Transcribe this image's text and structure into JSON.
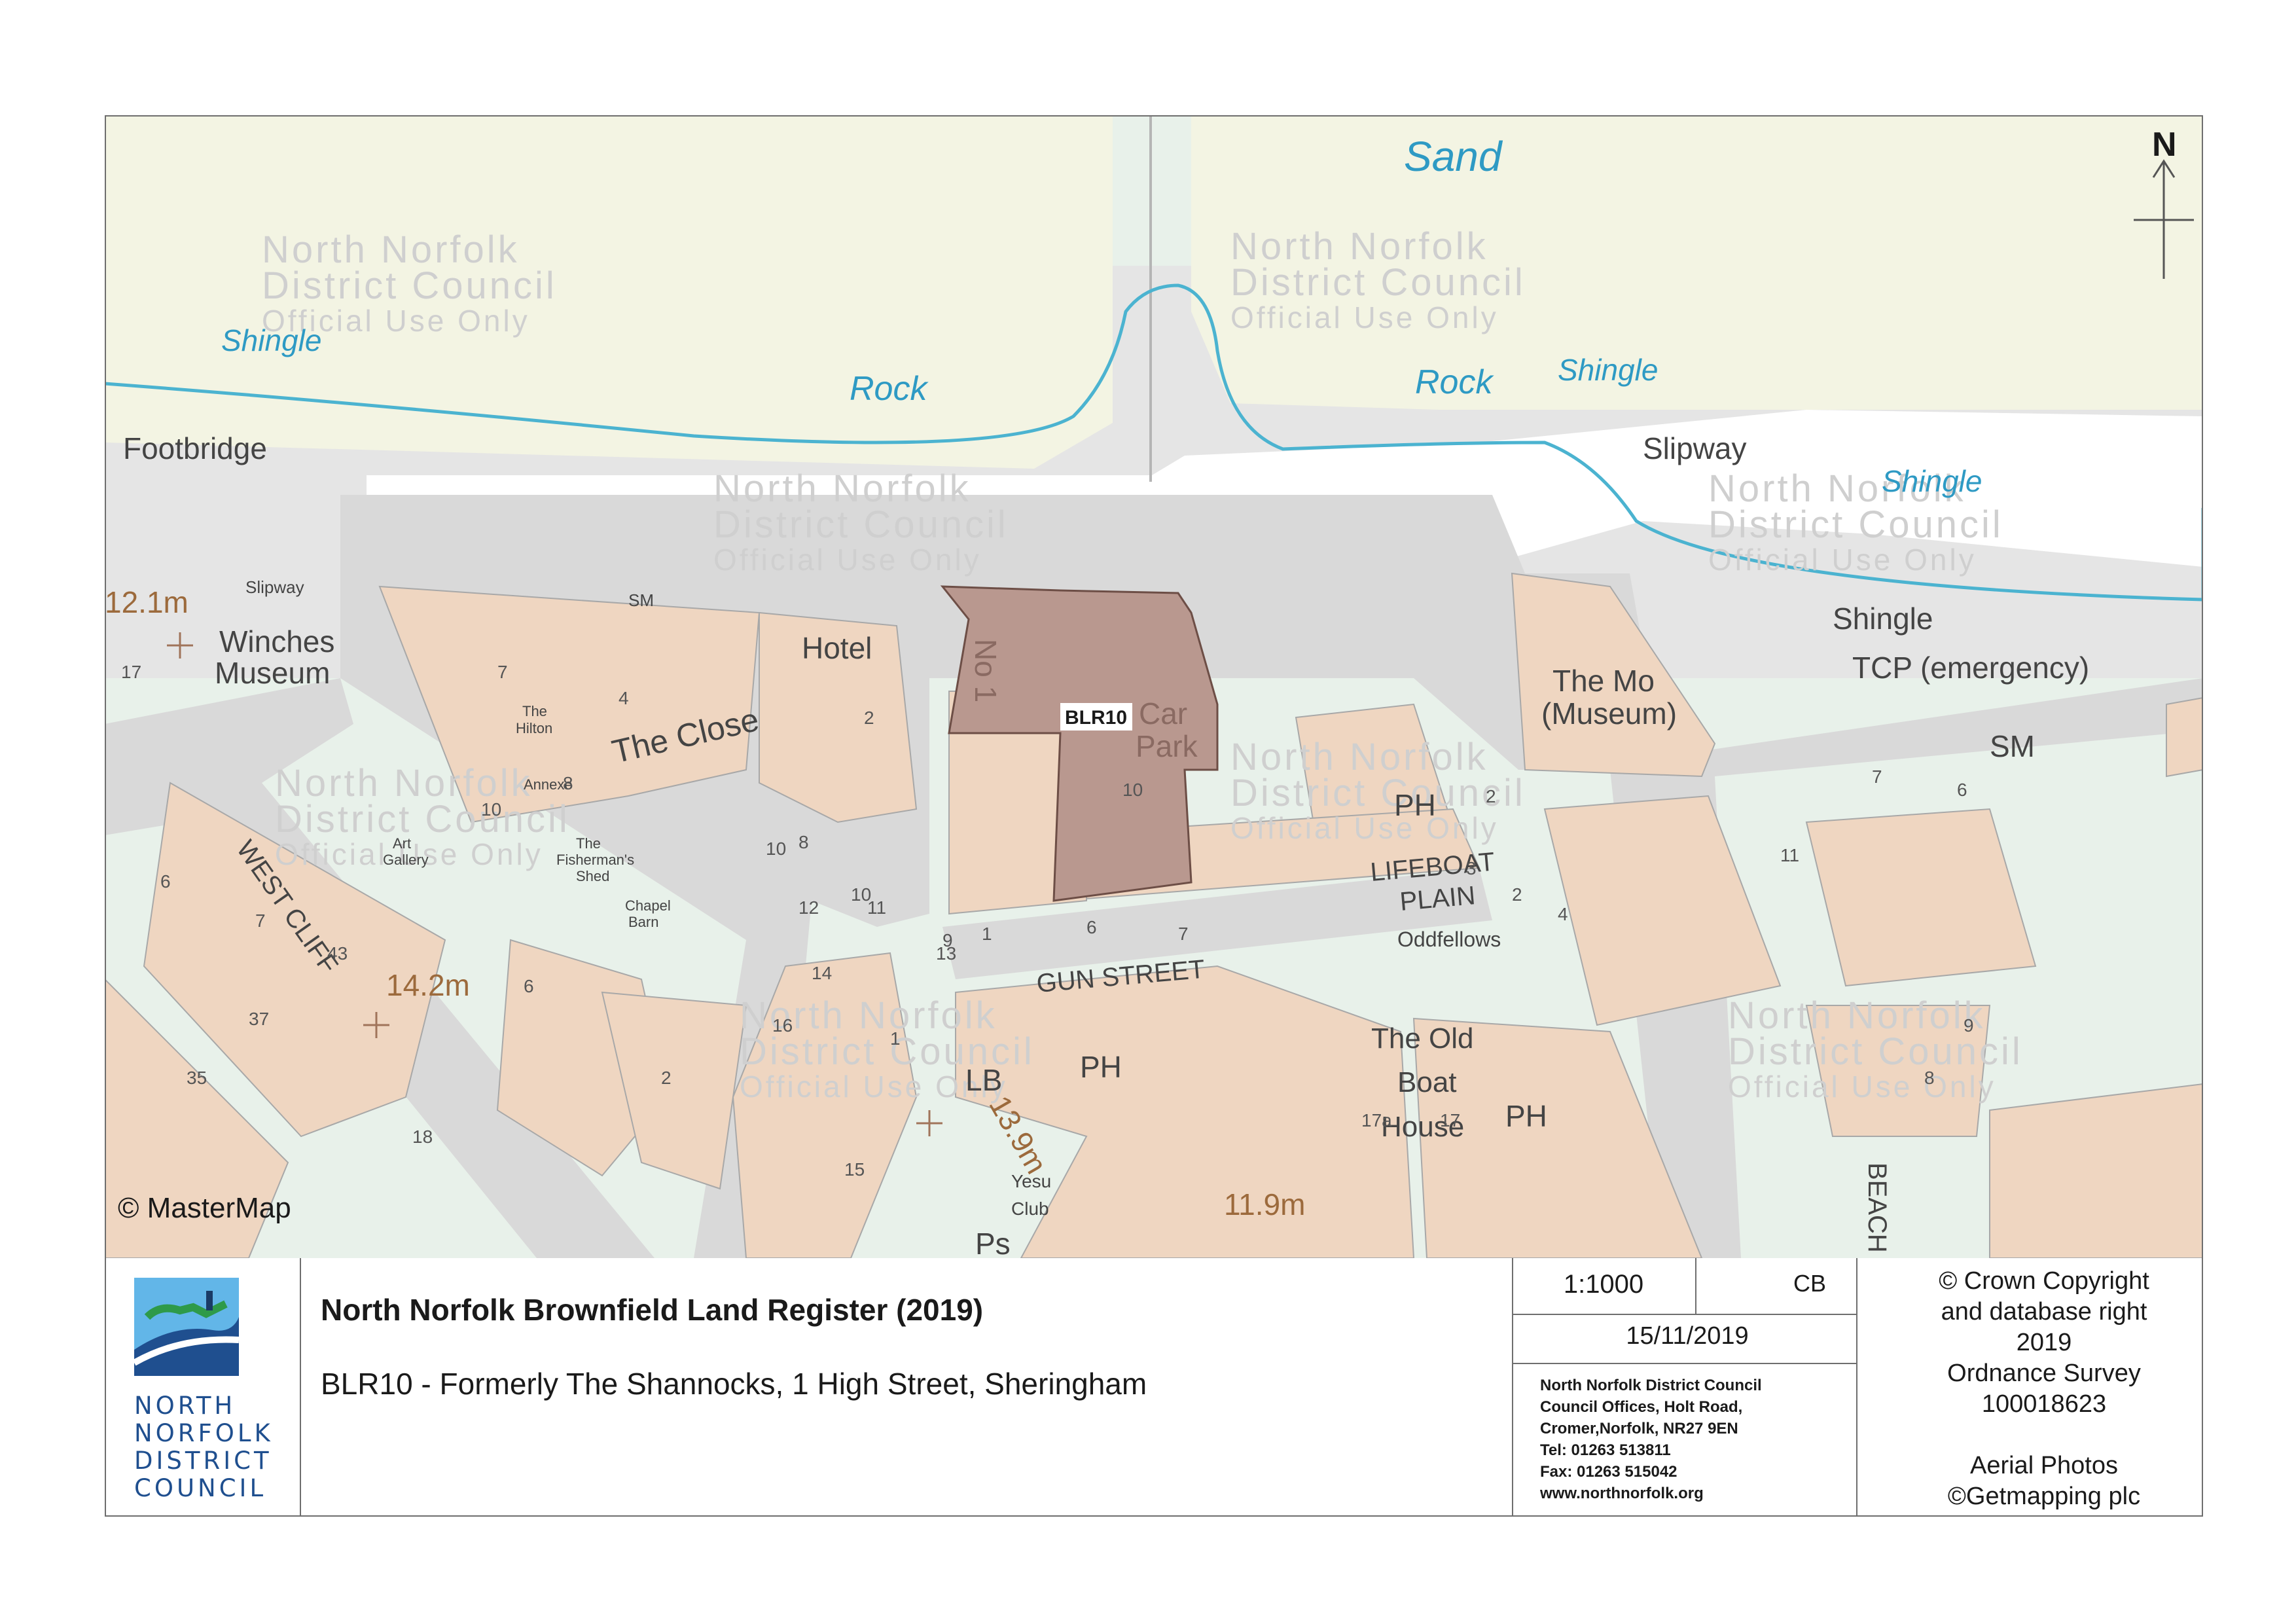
{
  "map": {
    "labels": {
      "sand": "Sand",
      "shingle_w": "Shingle",
      "shingle_c": "Shingle",
      "shingle_e": "Shingle",
      "shingle_se": "Shingle",
      "rock_w": "Rock",
      "rock_e": "Rock",
      "footbridge": "Footbridge",
      "slipway_e": "Slipway",
      "slipway_w": "Slipway",
      "sm_w": "SM",
      "sm_e": "SM",
      "tcp": "TCP (emergency)",
      "height_121": "12.1m",
      "height_142": "14.2m",
      "height_119": "11.9m",
      "height_139": "13.9m",
      "winches_1": "Winches",
      "winches_2": "Museum",
      "hotel": "Hotel",
      "the_close": "The Close",
      "the_hilton_1": "The",
      "the_hilton_2": "Hilton",
      "annexe": "Annexe",
      "art_1": "Art",
      "art_2": "Gallery",
      "fisherman_1": "The",
      "fisherman_2": "Fisherman's",
      "fisherman_3": "Shed",
      "chapel_1": "Chapel",
      "chapel_2": "Barn",
      "west_cliff": "WEST CLIFF",
      "gun_street": "GUN STREET",
      "lifeboat_1": "LIFEBOAT",
      "lifeboat_2": "PLAIN",
      "oddfellows": "Oddfellows",
      "mo_1": "The Mo",
      "mo_2": "(Museum)",
      "ph_1": "PH",
      "ph_2": "PH",
      "ph_3": "PH",
      "lb": "LB",
      "old_boat_1": "The Old",
      "old_boat_2": "Boat",
      "old_boat_3": "House",
      "yesu_1": "Yesu",
      "yesu_2": "Club",
      "ps": "Ps",
      "car_1": "Car",
      "car_2": "Park",
      "no1": "No 1",
      "beach": "BEACH",
      "site": "BLR10",
      "mastermap": "© MasterMap",
      "north": "N"
    },
    "house_numbers": [
      "7",
      "4",
      "2",
      "8",
      "10",
      "10",
      "8",
      "10",
      "11",
      "1",
      "6",
      "7",
      "10",
      "9",
      "6",
      "7",
      "43",
      "37",
      "35",
      "17",
      "6",
      "2",
      "12",
      "13",
      "14",
      "16",
      "15",
      "18",
      "17a",
      "17",
      "2",
      "3",
      "2",
      "4",
      "11",
      "7",
      "6",
      "9",
      "8",
      "1"
    ],
    "watermark": {
      "line1": "North Norfolk",
      "line2": "District Council",
      "line3": "Official Use Only"
    },
    "colors": {
      "sand": "#f3f4e3",
      "road": "#d9d9d9",
      "building": "#efd6c1",
      "garden": "#e7f1ea",
      "water_line": "#4bb3d0",
      "site": "#b9988f",
      "label_blue": "#2e9ac4",
      "height_brown": "#9c6a3c"
    }
  },
  "panel": {
    "title": "North Norfolk Brownfield Land Register (2019)",
    "subtitle": "BLR10 - Formerly The Shannocks, 1 High Street, Sheringham",
    "scale": "1:1000",
    "author": "CB",
    "date": "15/11/2019",
    "address": [
      "North Norfolk District Council",
      "Council Offices, Holt Road,",
      "Cromer,Norfolk, NR27 9EN",
      "Tel: 01263 513811",
      "Fax: 01263 515042",
      "www.northnorfolk.org"
    ],
    "copyright": [
      "© Crown Copyright",
      "and database right",
      "2019",
      "Ordnance Survey",
      "100018623",
      "",
      "Aerial Photos",
      "©Getmapping plc"
    ],
    "logo_text": [
      "NORTH",
      "NORFOLK",
      "DISTRICT",
      "COUNCIL"
    ]
  }
}
